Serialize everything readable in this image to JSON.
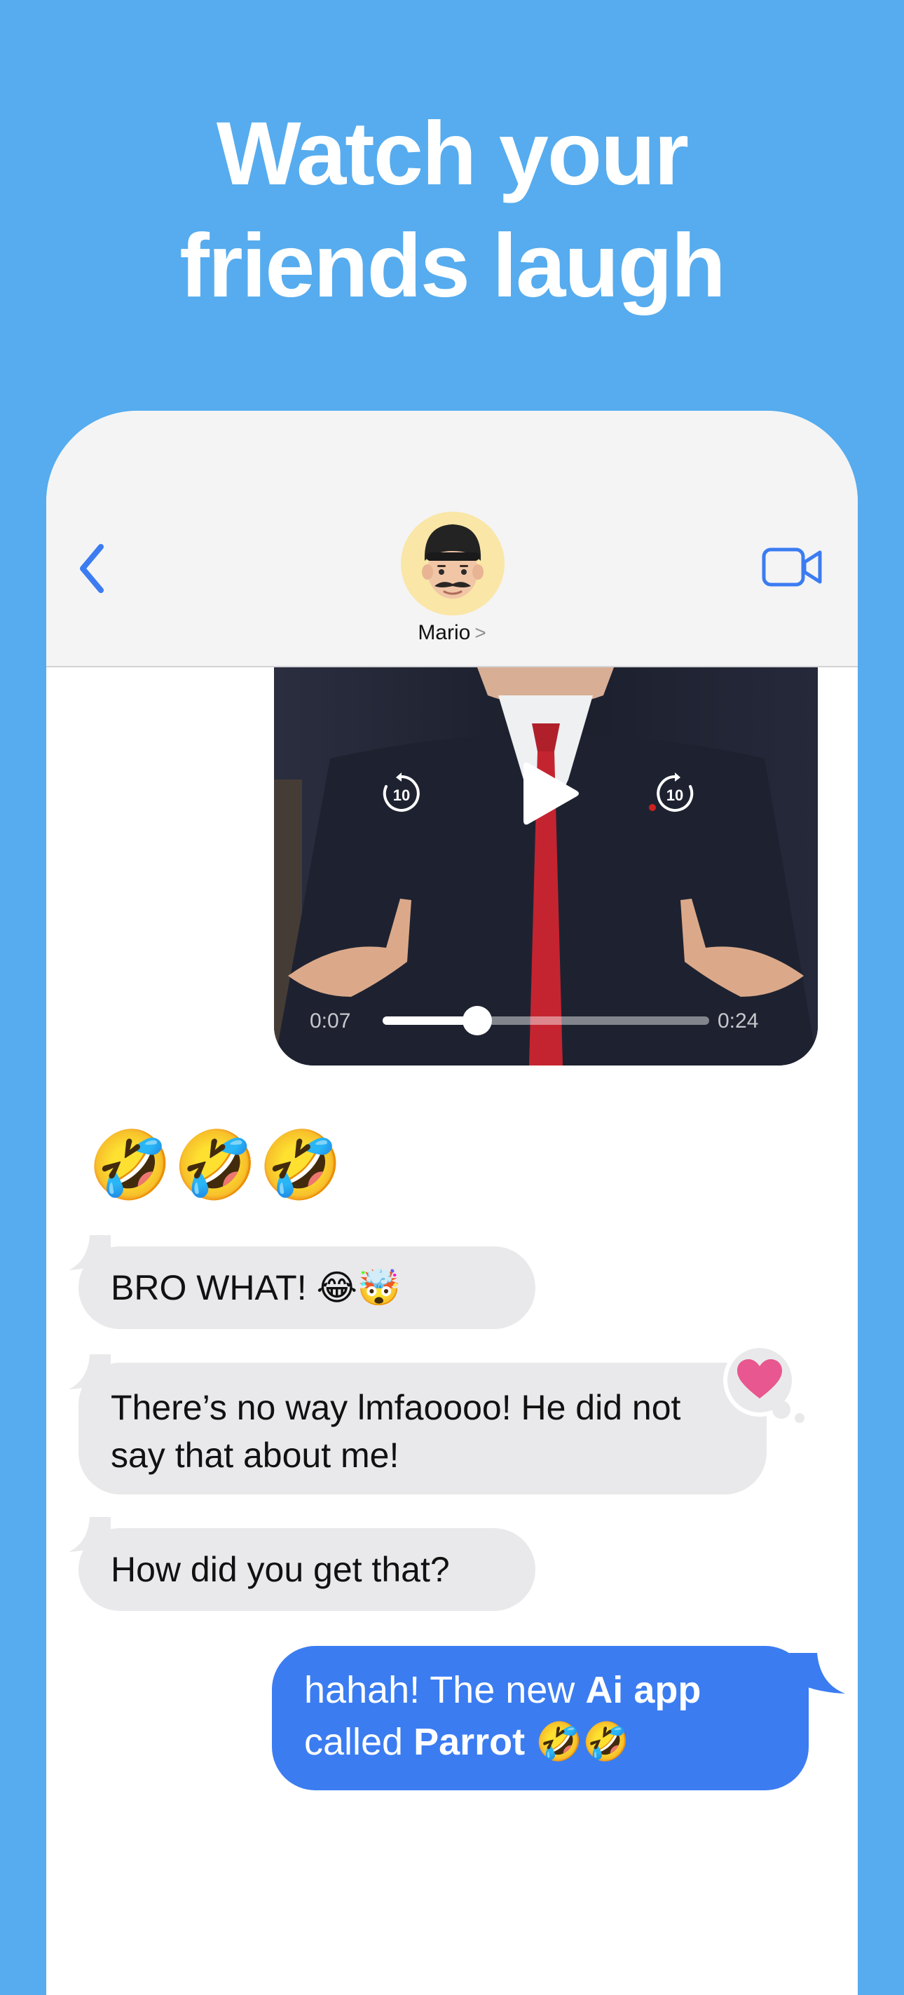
{
  "headline": {
    "line1": "Watch your",
    "line2": "friends laugh"
  },
  "colors": {
    "background": "#56acee",
    "accent": "#3b7cf1",
    "incoming_bubble": "#e9e9eb",
    "reaction_heart": "#e8578f"
  },
  "chat": {
    "contact_name": "Mario",
    "contact_chevron": ">",
    "back_icon": "chevron-left-icon",
    "video_call_icon": "video-camera-icon"
  },
  "video": {
    "current_time": "0:07",
    "total_time": "0:24",
    "progress": 0.29,
    "skip_back_label": "10",
    "skip_forward_label": "10",
    "play_icon": "play-icon"
  },
  "messages": {
    "emoji_reaction": "🤣🤣🤣",
    "incoming_1": "BRO WHAT! 😂🤯",
    "incoming_2": "There’s no way lmfaoooo! He did not say that about me!",
    "incoming_3": "How did you get that?",
    "outgoing_1": {
      "part1": "hahah! The new ",
      "bold1": "Ai app",
      "part2": "called ",
      "bold2": "Parrot",
      "part3": " 🤣🤣"
    },
    "reaction_icon": "heart-icon"
  }
}
